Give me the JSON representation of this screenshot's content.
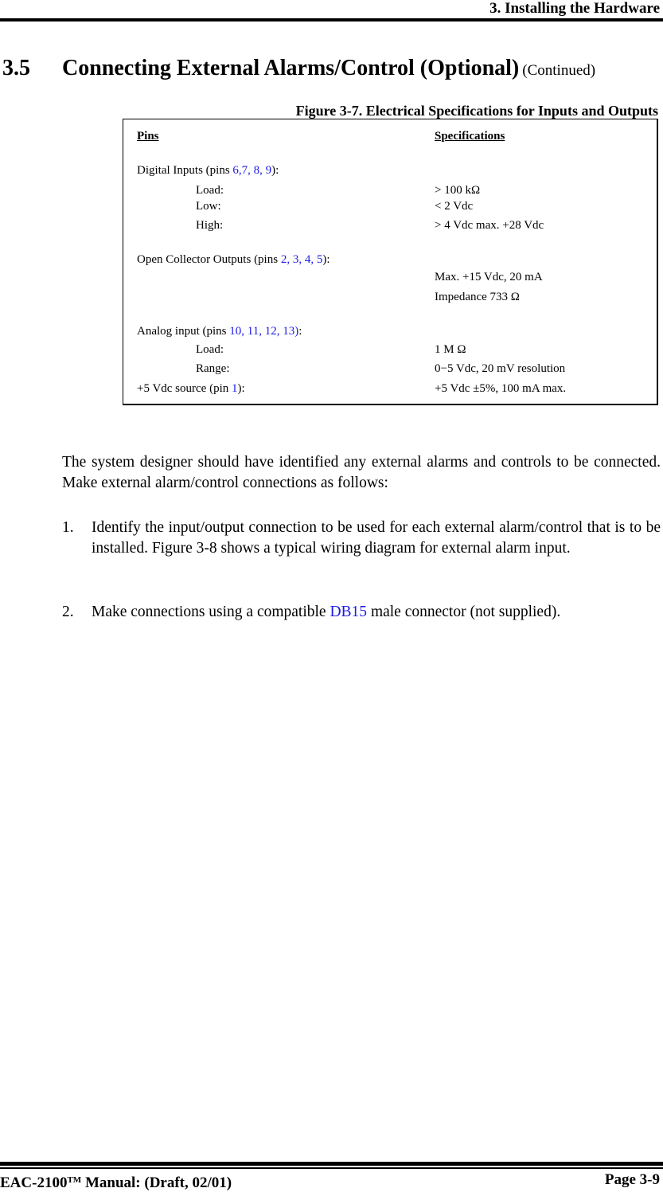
{
  "header": {
    "chapter_title": "3. Installing the Hardware"
  },
  "section": {
    "number": "3.5",
    "title": "Connecting External Alarms/Control (Optional)",
    "continued": "(Continued)"
  },
  "figure": {
    "caption": "Figure 3-7. Electrical Specifications for Inputs and Outputs",
    "headers": {
      "pins": "Pins",
      "specifications": "Specifications"
    },
    "digital_inputs": {
      "label_prefix": "Digital Inputs (pins ",
      "pins": "6,7, 8, 9",
      "label_suffix": "):",
      "rows": [
        {
          "name": "Load:",
          "spec": "> 100 kΩ"
        },
        {
          "name": "Low:",
          "spec": "< 2 Vdc"
        },
        {
          "name": "High:",
          "spec": "> 4 Vdc max. +28 Vdc"
        }
      ]
    },
    "open_collector_outputs": {
      "label_prefix": "Open Collector Outputs (pins ",
      "pins": "2, 3, 4, 5",
      "label_suffix": "):",
      "specs": [
        "Max. +15 Vdc, 20 mA",
        "Impedance 733 Ω"
      ]
    },
    "analog_input": {
      "label_prefix": "Analog input (pins ",
      "pins": "10, 11, 12, 13)",
      "label_suffix": ":",
      "rows": [
        {
          "name": "Load:",
          "spec": "1 M Ω"
        },
        {
          "name": "Range:",
          "spec": "0−5 Vdc, 20 mV resolution"
        }
      ]
    },
    "vdc_source": {
      "label_prefix": "+5 Vdc source (pin ",
      "pins": "1",
      "label_suffix": "):",
      "spec": "+5 Vdc ±5%, 100 mA max."
    }
  },
  "body": {
    "intro": "The system designer should have identified any external alarms and controls to be connected. Make external alarm/control connections as follows:",
    "steps": [
      {
        "number": "1.",
        "text": "Identify the input/output connection to be used for each external alarm/control that is to be installed. Figure 3-8 shows a typical wiring diagram for external alarm input."
      },
      {
        "number": "2.",
        "text_before": "Make connections using a compatible ",
        "link": "DB15",
        "text_after": " male connector (not supplied)."
      }
    ]
  },
  "footer": {
    "product": "EAC-2100",
    "trademark": "TM",
    "manual": " Manual: (Draft, 02/01)",
    "page": "Page 3-9"
  },
  "colors": {
    "link_blue": "#1a1ae6",
    "text": "#000000"
  }
}
